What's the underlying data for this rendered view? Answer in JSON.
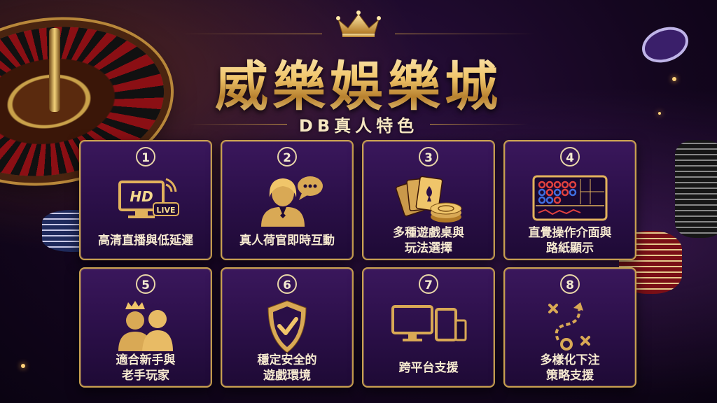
{
  "header": {
    "title": "威樂娛樂城",
    "subtitle": "DB真人特色"
  },
  "colors": {
    "gold": "#d9a955",
    "card_bg": "#2a0f47",
    "border": "#c9a050"
  },
  "features": [
    {
      "num": "1",
      "label": "高清直播與低延遲",
      "icon": "hd-live-monitor-icon"
    },
    {
      "num": "2",
      "label": "真人荷官即時互動",
      "icon": "dealer-chat-icon"
    },
    {
      "num": "3",
      "label": "多種遊戲桌與\n玩法選擇",
      "icon": "cards-chips-icon"
    },
    {
      "num": "4",
      "label": "直覺操作介面與\n路紙顯示",
      "icon": "road-map-board-icon"
    },
    {
      "num": "5",
      "label": "適合新手與\n老手玩家",
      "icon": "players-crown-icon"
    },
    {
      "num": "6",
      "label": "穩定安全的\n遊戲環境",
      "icon": "shield-check-icon"
    },
    {
      "num": "7",
      "label": "跨平台支援",
      "icon": "multi-device-icon"
    },
    {
      "num": "8",
      "label": "多樣化下注\n策略支援",
      "icon": "strategy-play-icon"
    }
  ],
  "icon_text": {
    "hd": "HD",
    "live": "LIVE"
  }
}
